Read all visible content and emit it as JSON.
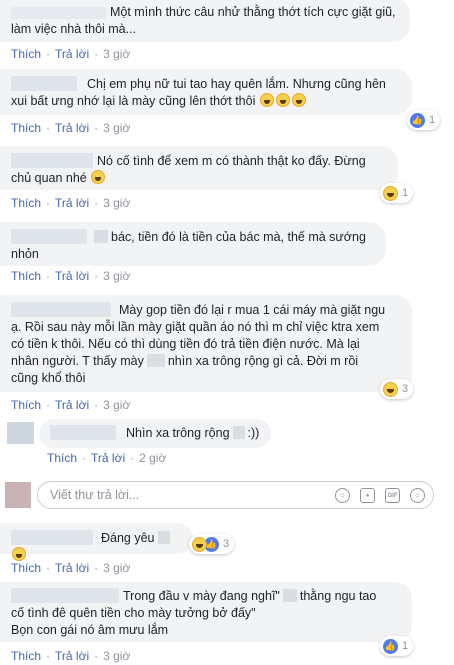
{
  "actions": {
    "like": "Thích",
    "reply": "Trả lời",
    "sep": "·"
  },
  "comments": [
    {
      "text_before": "Một mình thức câu nhử thằng thớt tích cực giặt giũ,",
      "text_line2": "làm việc nhà thôi mà...",
      "time": "3 giờ"
    },
    {
      "text_before": "Chị em phụ nữ tui tao hay quên lắm. Nhưng cũng hên",
      "text_line2": "xui bất ưng nhớ lại là mày cũng lên thớt thôi",
      "time": "3 giờ",
      "reaction_count": "1"
    },
    {
      "text_before": "Nó cố tình để xem m có thành thật ko đấy. Đừng",
      "text_line2": "chủ quan nhé",
      "time": "3 giờ",
      "reaction_count": "1"
    },
    {
      "text_before": "bác, tiền đó là tiền của bác mà, thế mà sướng",
      "text_line2": "nhỏn",
      "time": "3 giờ"
    },
    {
      "text_before": "Mày gop tiền đó lại r mua 1 cái máy mà giặt ngu",
      "text_line2": "ạ. Rồi sau này mỗi lần mày giặt quần áo nó thì m chỉ việc ktra xem",
      "text_line3": "có tiền k thôi. Nếu có thì dùng tiền đó trả tiền điện nước. Mà lại",
      "text_line4": "nhân người. T thấy mày",
      "text_line4b": "nhìn xa trông rộng gì cả. Đời m rồi",
      "text_line5": "cũng khổ thôi",
      "time": "3 giờ",
      "reaction_count": "3"
    }
  ],
  "reply": {
    "text": "Nhìn xa trông rộng",
    "text_tail": ":))",
    "time": "2 giờ"
  },
  "reply_box": {
    "placeholder": "Viết thư trả lời..."
  },
  "comment6": {
    "text": "Đáng yêu",
    "time": "3 giờ",
    "reaction_count": "3"
  },
  "comment7": {
    "line1_a": "Trong đầu v mày đang nghĩ\"",
    "line1_b": "thằng ngu tao",
    "line2": "cố tình đê quên tiền cho mày tưởng bở đấy\"",
    "line3": "Bọn con gái nó âm mưu lắm",
    "time": "3 giờ",
    "reaction_count": "1"
  },
  "icons": [
    "like-icon",
    "haha-icon",
    "smiley-icon",
    "camera-icon",
    "gif-icon",
    "sticker-icon"
  ]
}
